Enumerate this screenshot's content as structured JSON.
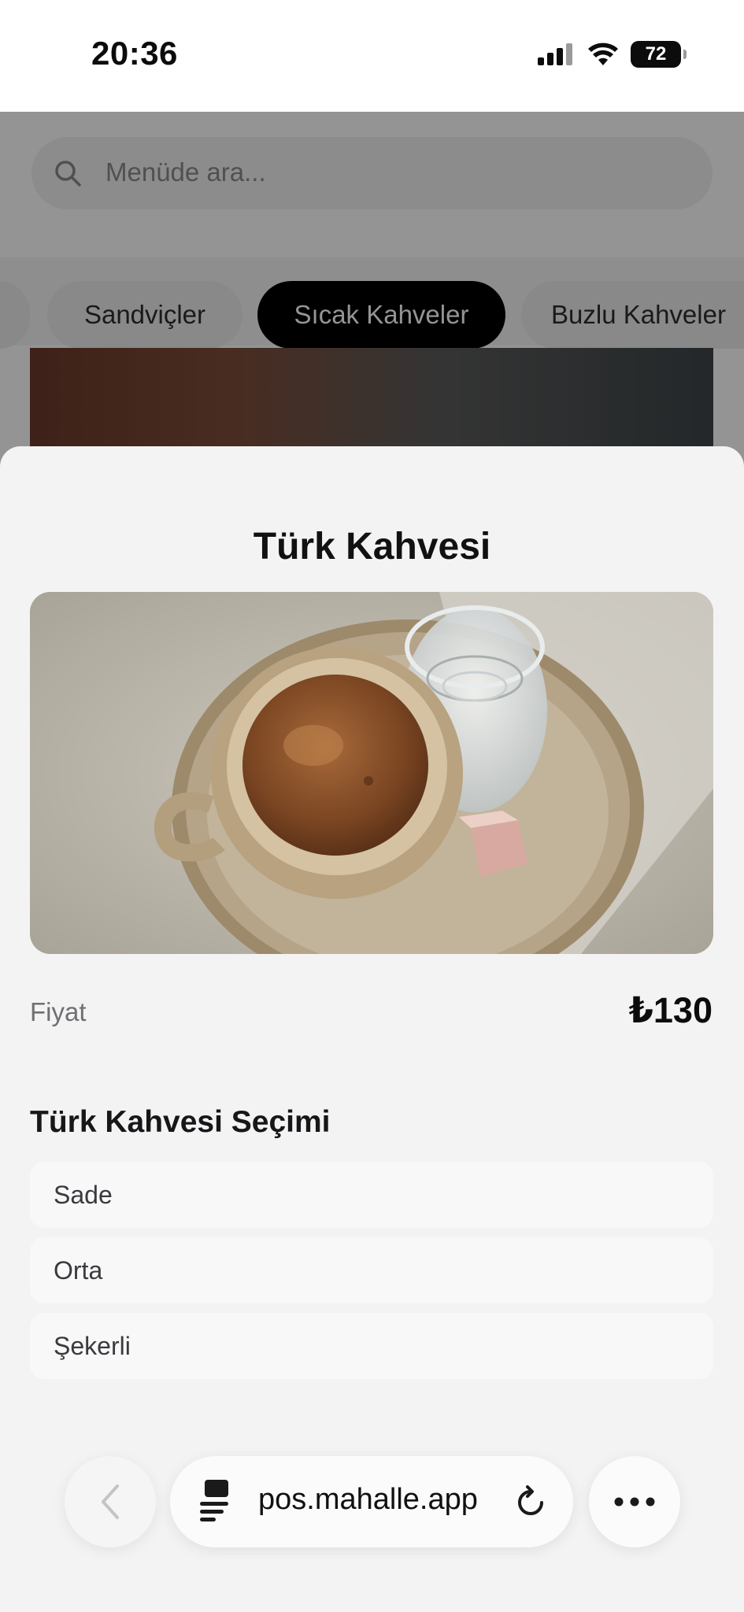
{
  "status_bar": {
    "time": "20:36",
    "battery": "72",
    "icons": [
      "signal-icon",
      "wifi-icon",
      "battery-icon"
    ]
  },
  "search": {
    "placeholder": "Menüde ara..."
  },
  "categories": {
    "items": [
      "Sandviçler",
      "Sıcak Kahveler",
      "Buzlu Kahveler"
    ],
    "active": "Sıcak Kahveler"
  },
  "product": {
    "title": "Türk Kahvesi",
    "price_label": "Fiyat",
    "price_value": "₺130",
    "image_icon": "turkish-coffee-photo"
  },
  "options": {
    "title": "Türk Kahvesi Seçimi",
    "items": [
      "Sade",
      "Orta",
      "Şekerli"
    ]
  },
  "browser": {
    "url": "pos.mahalle.app",
    "icons": [
      "back-icon",
      "page-icon",
      "reload-icon",
      "more-icon"
    ]
  },
  "colors": {
    "active_tab": "#000000",
    "sheet_background": "#f3f3f4",
    "option_background": "#f8f8f9"
  }
}
